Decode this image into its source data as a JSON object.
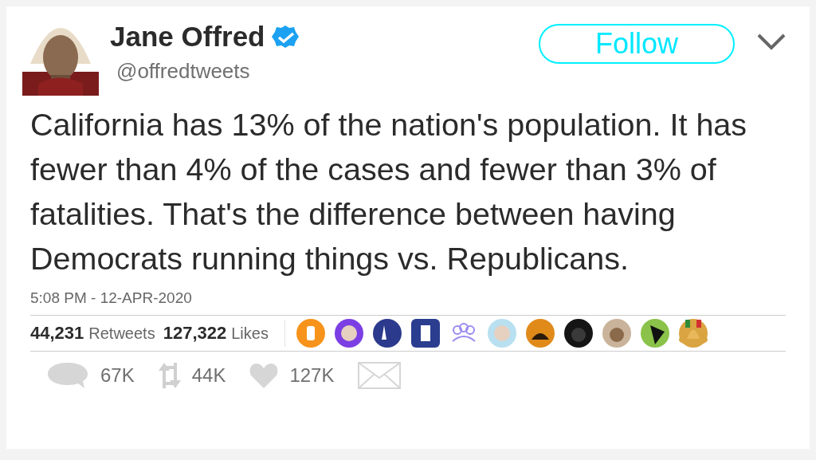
{
  "author": {
    "name": "Jane Offred",
    "verified": true,
    "handle": "@offredtweets"
  },
  "follow_button": {
    "label": "Follow"
  },
  "tweet": {
    "text": "California has 13% of the nation's population. It has fewer than 4% of the cases and fewer than 3% of fatalities. That's the difference between having Democrats running things vs. Republicans.",
    "timestamp": "5:08 PM - 12-APR-2020"
  },
  "stats": [
    {
      "count": "44,231",
      "label": "Retweets"
    },
    {
      "count": "127,322",
      "label": "Likes"
    }
  ],
  "actions": [
    {
      "kind": "reply",
      "count": "67K"
    },
    {
      "kind": "retweet",
      "count": "44K"
    },
    {
      "kind": "like",
      "count": "127K"
    },
    {
      "kind": "message"
    }
  ]
}
